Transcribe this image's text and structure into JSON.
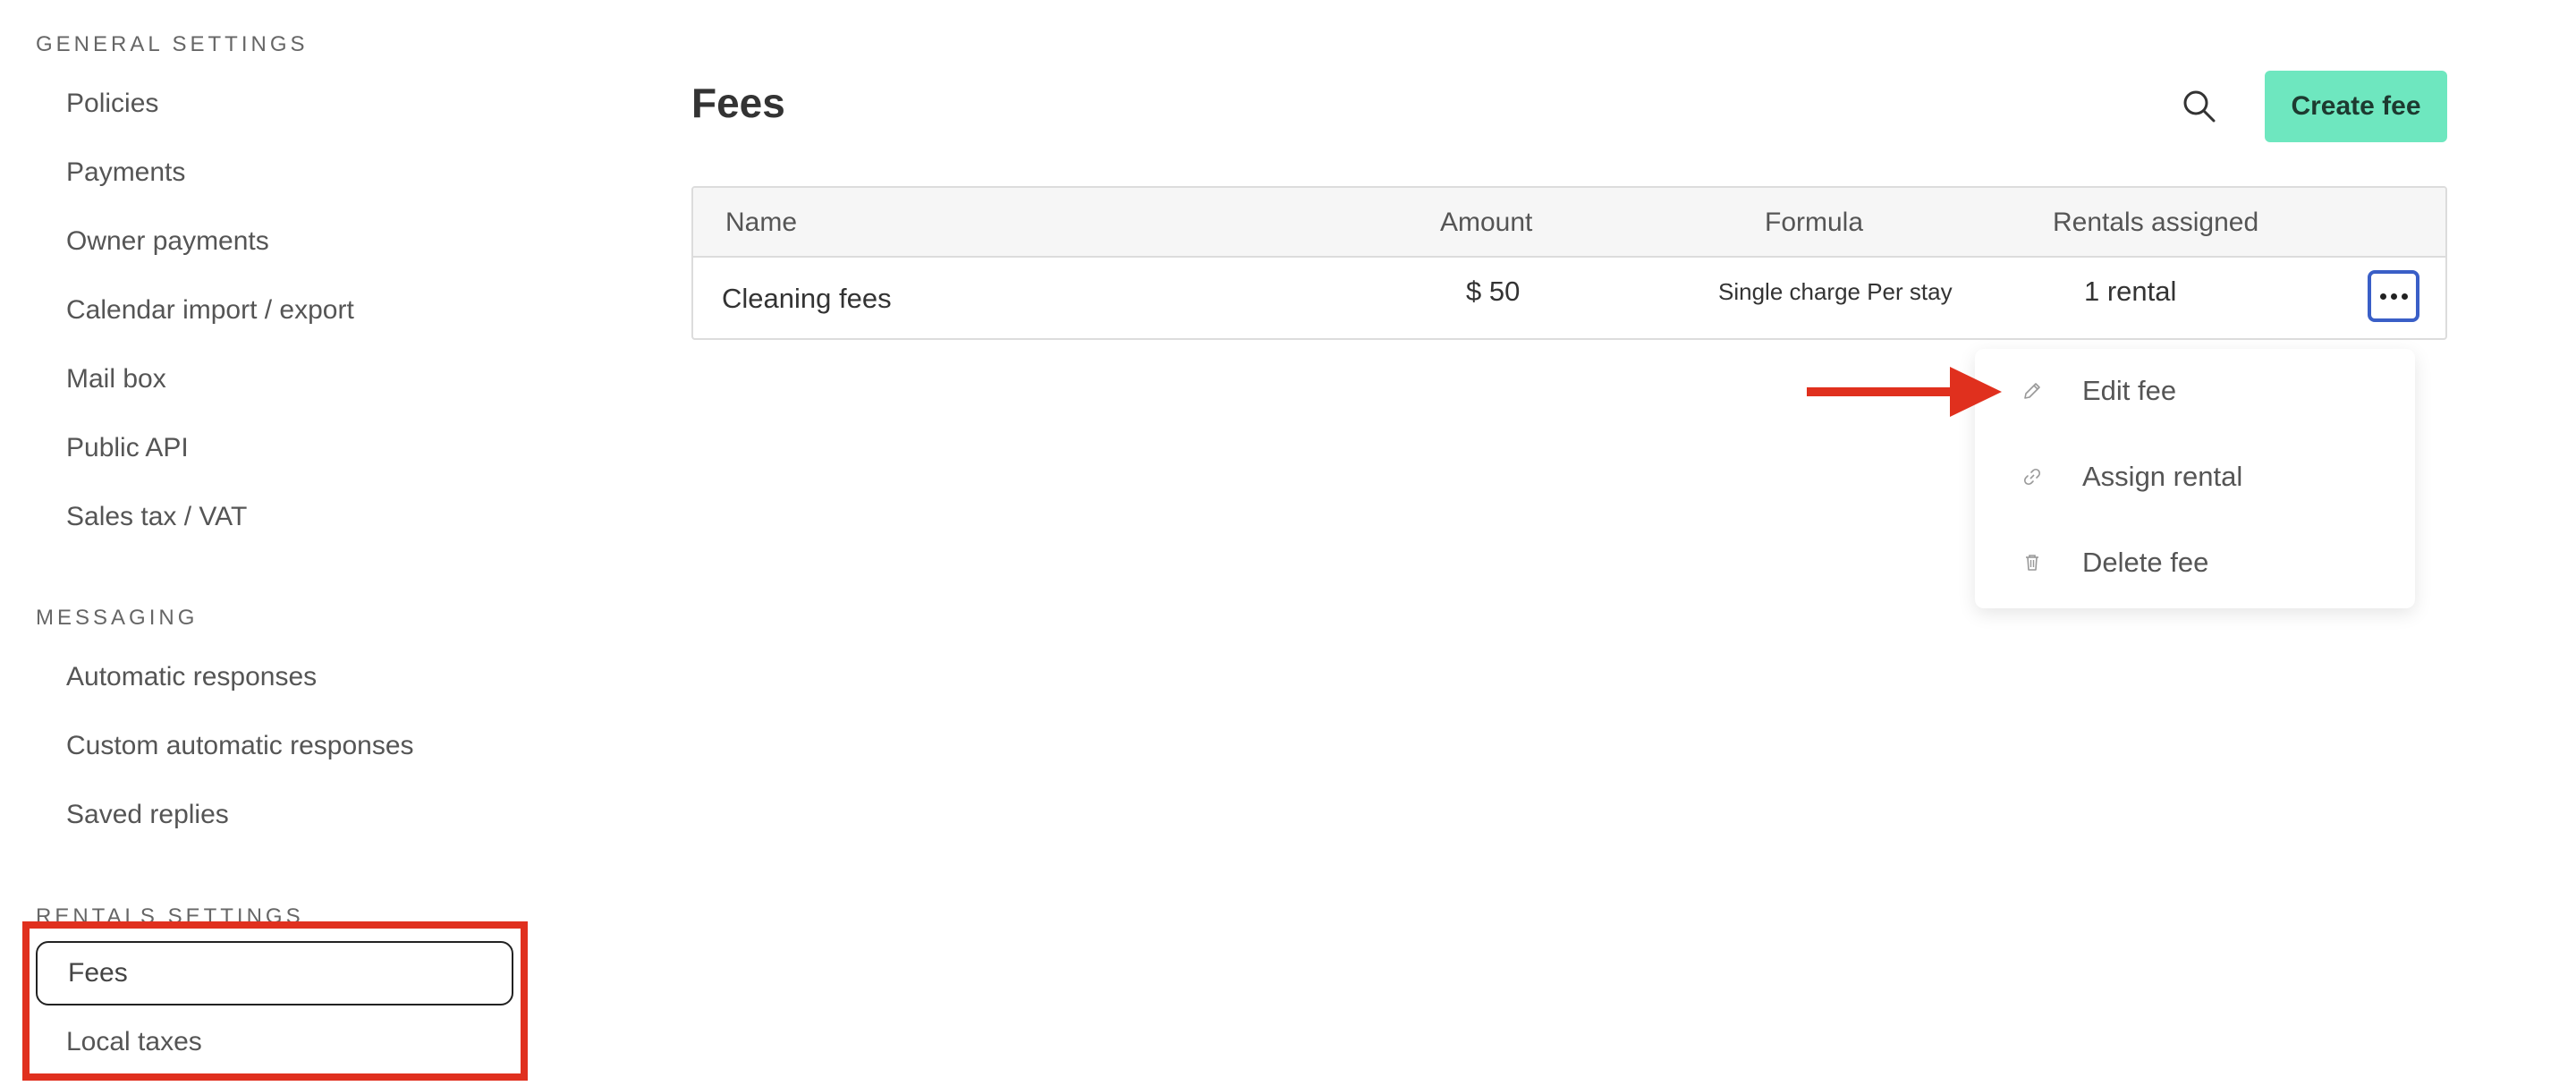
{
  "sidebar": {
    "general_title": "GENERAL SETTINGS",
    "general_items": [
      "Policies",
      "Payments",
      "Owner payments",
      "Calendar import / export",
      "Mail box",
      "Public API",
      "Sales tax / VAT"
    ],
    "messaging_title": "MESSAGING",
    "messaging_items": [
      "Automatic responses",
      "Custom automatic responses",
      "Saved replies"
    ],
    "rentals_title": "RENTALS SETTINGS",
    "rentals_items": [
      "Fees",
      "Local taxes"
    ],
    "active_item": "Fees"
  },
  "main": {
    "title": "Fees",
    "create_button": "Create fee",
    "search_icon": "search-icon",
    "table": {
      "headers": [
        "Name",
        "Amount",
        "Formula",
        "Rentals assigned"
      ],
      "rows": [
        {
          "name": "Cleaning fees",
          "amount": "$ 50",
          "formula": "Single charge Per stay",
          "rentals": "1 rental"
        }
      ]
    },
    "row_menu": {
      "items": [
        {
          "icon": "pencil-icon",
          "label": "Edit fee"
        },
        {
          "icon": "link-icon",
          "label": "Assign rental"
        },
        {
          "icon": "trash-icon",
          "label": "Delete fee"
        }
      ]
    }
  },
  "annotations": {
    "highlight_color": "#e0301e"
  }
}
